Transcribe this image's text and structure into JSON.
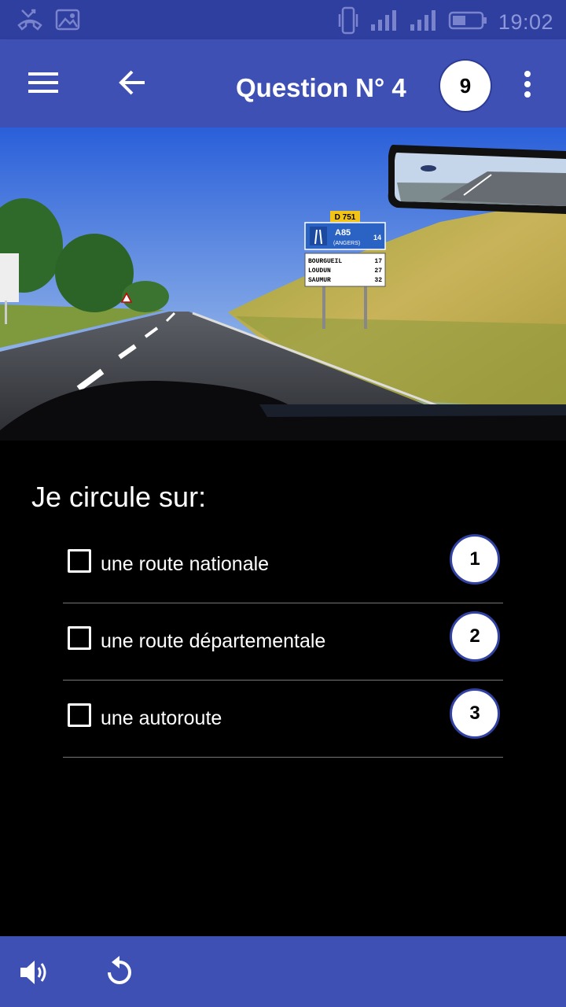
{
  "status_bar": {
    "time": "19:02",
    "icons": [
      "missed-call-icon",
      "image-icon",
      "vibrate-icon",
      "signal-icon",
      "signal-icon",
      "battery-icon"
    ]
  },
  "app_bar": {
    "title": "Question N° 4",
    "question_count": "9",
    "icons": [
      "menu-icon",
      "back-arrow-icon",
      "more-vert-icon"
    ]
  },
  "photo": {
    "signs": {
      "road_number": "D 751",
      "motorway": "A85",
      "motorway_dest": "(ANGERS)",
      "motorway_km": "14",
      "destinations": [
        {
          "name": "BOURGUEIL",
          "km": "17"
        },
        {
          "name": "LOUDUN",
          "km": "27"
        },
        {
          "name": "SAUMUR",
          "km": "32"
        }
      ]
    }
  },
  "question": {
    "text": "Je circule sur:",
    "answers": [
      {
        "label": "une route nationale",
        "number": "1",
        "checked": false
      },
      {
        "label": "une route départementale",
        "number": "2",
        "checked": false
      },
      {
        "label": "une autoroute",
        "number": "3",
        "checked": false
      }
    ]
  },
  "bottom_bar": {
    "icons": [
      "volume-icon",
      "replay-icon"
    ]
  },
  "colors": {
    "primary": "#3e50b4",
    "status_bar": "#2f3fa0",
    "background": "#000000"
  }
}
